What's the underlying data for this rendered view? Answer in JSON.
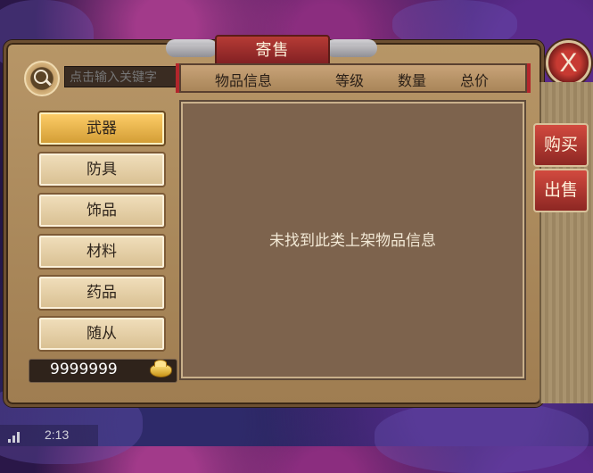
{
  "window": {
    "title": "寄售",
    "close_label": "X"
  },
  "search": {
    "placeholder": "点击输入关键字"
  },
  "table_header": {
    "item_info": "物品信息",
    "level": "等级",
    "quantity": "数量",
    "total_price": "总价"
  },
  "categories": [
    {
      "label": "武器"
    },
    {
      "label": "防具"
    },
    {
      "label": "饰品"
    },
    {
      "label": "材料"
    },
    {
      "label": "药品"
    },
    {
      "label": "随从"
    }
  ],
  "side_tabs": {
    "buy": "购买",
    "sell": "出售"
  },
  "currency": {
    "amount": "9999999"
  },
  "list": {
    "empty_message": "未找到此类上架物品信息"
  },
  "status_bar": {
    "time": "2:13"
  }
}
